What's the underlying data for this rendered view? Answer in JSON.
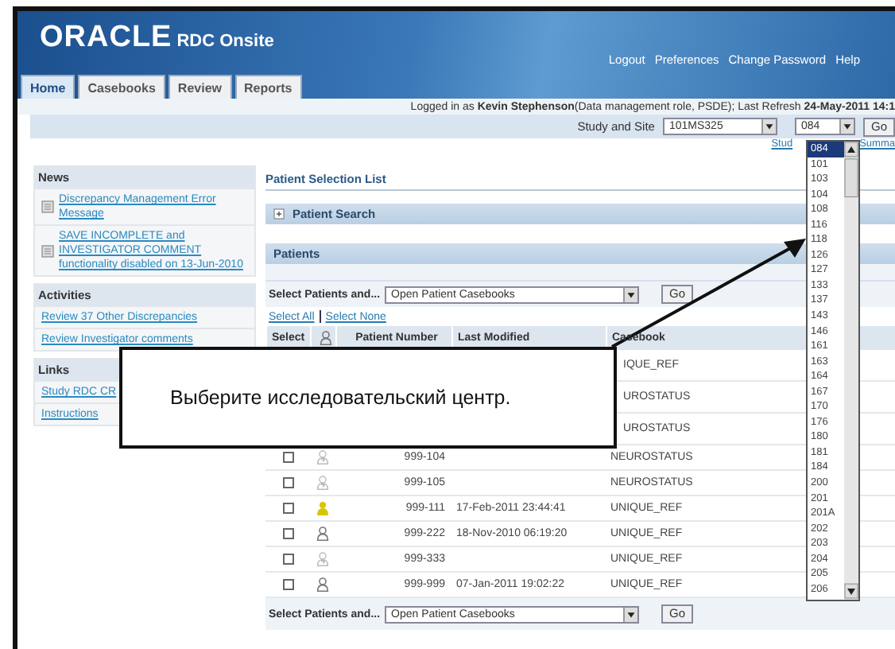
{
  "header": {
    "logo": "ORACLE",
    "product": "RDC Onsite",
    "global_links": [
      "Logout",
      "Preferences",
      "Change Password",
      "Help"
    ]
  },
  "tabs": [
    {
      "label": "Home",
      "selected": true
    },
    {
      "label": "Casebooks",
      "selected": false
    },
    {
      "label": "Review",
      "selected": false
    },
    {
      "label": "Reports",
      "selected": false
    }
  ],
  "login": {
    "prefix": "Logged in as",
    "user": "Kevin Stephenson",
    "role": "(Data management role, PSDE); Last Refresh",
    "refresh": "24-May-2011 14:1"
  },
  "study_bar": {
    "label": "Study and Site",
    "study": "101MS325",
    "site": "084",
    "go": "Go"
  },
  "sub_links": [
    "Stud",
    "Summa"
  ],
  "site_list": [
    {
      "label": "084",
      "selected": true
    },
    {
      "label": "101",
      "selected": false
    },
    {
      "label": "103",
      "selected": false
    },
    {
      "label": "104",
      "selected": false
    },
    {
      "label": "108",
      "selected": false
    },
    {
      "label": "116",
      "selected": false
    },
    {
      "label": "118",
      "selected": false
    },
    {
      "label": "126",
      "selected": false
    },
    {
      "label": "127",
      "selected": false
    },
    {
      "label": "133",
      "selected": false
    },
    {
      "label": "137",
      "selected": false
    },
    {
      "label": "143",
      "selected": false
    },
    {
      "label": "146",
      "selected": false
    },
    {
      "label": "161",
      "selected": false
    },
    {
      "label": "163",
      "selected": false
    },
    {
      "label": "164",
      "selected": false
    },
    {
      "label": "167",
      "selected": false
    },
    {
      "label": "170",
      "selected": false
    },
    {
      "label": "176",
      "selected": false
    },
    {
      "label": "180",
      "selected": false
    },
    {
      "label": "181",
      "selected": false
    },
    {
      "label": "184",
      "selected": false
    },
    {
      "label": "200",
      "selected": false
    },
    {
      "label": "201",
      "selected": false
    },
    {
      "label": "201A",
      "selected": false
    },
    {
      "label": "202",
      "selected": false
    },
    {
      "label": "203",
      "selected": false
    },
    {
      "label": "204",
      "selected": false
    },
    {
      "label": "205",
      "selected": false
    },
    {
      "label": "206",
      "selected": false
    }
  ],
  "sidebar": [
    {
      "title": "News",
      "items": [
        {
          "text": "Discrepancy Management Error Message",
          "kind": "news"
        },
        {
          "text": "SAVE INCOMPLETE and INVESTIGATOR COMMENT functionality disabled on 13-Jun-2010",
          "kind": "news"
        }
      ]
    },
    {
      "title": "Activities",
      "items": [
        {
          "text": "Review 37 Other Discrepancies",
          "kind": "link"
        },
        {
          "text": "Review Investigator comments",
          "kind": "link"
        }
      ]
    },
    {
      "title": "Links",
      "items": [
        {
          "text": "Study RDC CR",
          "kind": "link"
        },
        {
          "text": "Instructions",
          "kind": "link"
        }
      ]
    }
  ],
  "main": {
    "title": "Patient Selection List",
    "search_title": "Patient Search",
    "patients_title": "Patients",
    "action_label": "Select Patients and...",
    "action_value": "Open Patient Casebooks",
    "action_go": "Go",
    "select_all": "Select All",
    "select_none": "Select None",
    "columns": [
      "Select",
      "Patient Number",
      "Last Modified",
      "Casebook"
    ],
    "rows": [
      {
        "casebook": "IQUE_REF"
      },
      {
        "casebook": "UROSTATUS"
      },
      {
        "casebook": "UROSTATUS"
      },
      {
        "checked": false,
        "kind": "unknown",
        "number": "999-104",
        "modified": "",
        "casebook": "NEUROSTATUS"
      },
      {
        "checked": false,
        "kind": "unknown",
        "number": "999-105",
        "modified": "",
        "casebook": "NEUROSTATUS"
      },
      {
        "checked": false,
        "kind": "active",
        "number": "999-111",
        "modified": "17-Feb-2011 23:44:41",
        "casebook": "UNIQUE_REF"
      },
      {
        "checked": false,
        "kind": "person",
        "number": "999-222",
        "modified": "18-Nov-2010 06:19:20",
        "casebook": "UNIQUE_REF"
      },
      {
        "checked": false,
        "kind": "unknown",
        "number": "999-333",
        "modified": "",
        "casebook": "UNIQUE_REF"
      },
      {
        "checked": false,
        "kind": "person",
        "number": "999-999",
        "modified": "07-Jan-2011 19:02:22",
        "casebook": "UNIQUE_REF"
      }
    ],
    "bottom_label": "Select Patients and...",
    "bottom_value": "Open Patient Casebooks",
    "bottom_go": "Go"
  },
  "callout": {
    "text": "Выберите исследовательский центр."
  }
}
